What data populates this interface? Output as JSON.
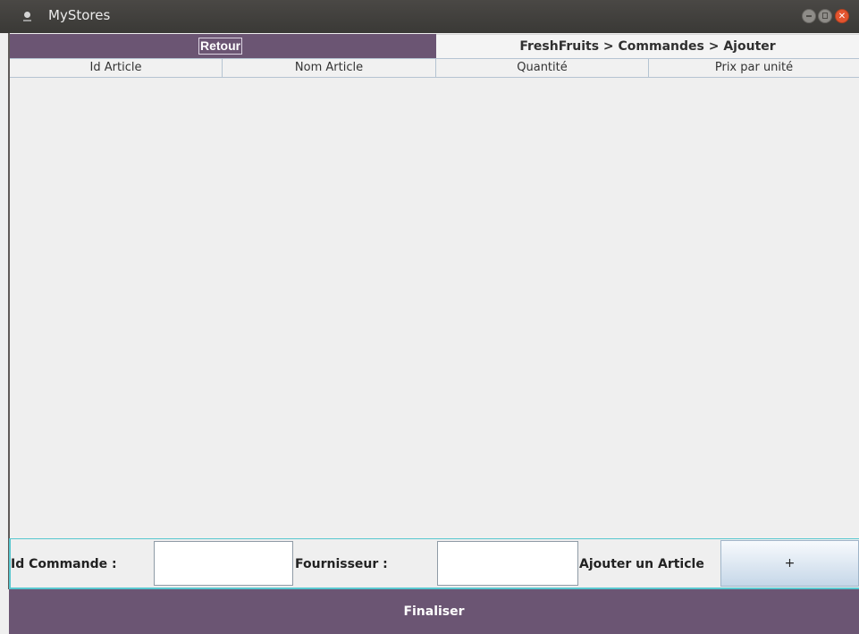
{
  "window": {
    "title": "MyStores"
  },
  "top": {
    "back_label": "Retour",
    "breadcrumb": "FreshFruits > Commandes > Ajouter"
  },
  "table": {
    "columns": [
      "Id Article",
      "Nom Article",
      "Quantité",
      "Prix par unité"
    ],
    "rows": []
  },
  "form": {
    "id_label": "Id Commande :",
    "id_value": "",
    "supplier_label": "Fournisseur :",
    "supplier_value": "",
    "add_label": "Ajouter un Article",
    "add_button": "+"
  },
  "footer": {
    "finalize_label": "Finaliser"
  },
  "colors": {
    "accent": "#6b5573",
    "field_border": "#58c7cf"
  }
}
